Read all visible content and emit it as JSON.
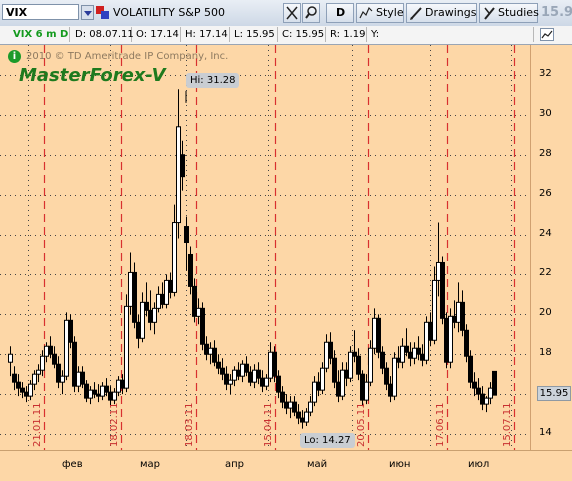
{
  "toolbar": {
    "symbol": "VIX",
    "description": "VOLATILITY S&P 500",
    "period_label": "D",
    "style_label": "Style",
    "drawings_label": "Drawings",
    "studies_label": "Studies",
    "last_price": "15.95"
  },
  "infobar": {
    "timeframe": "VIX 6 m D",
    "date": "D: 08.07.11",
    "open": "O: 17.14",
    "high": "H: 17.14",
    "low": "L: 15.95",
    "close": "C: 15.95",
    "range": "R: 1.19",
    "y": "Y:"
  },
  "chart": {
    "copyright": "2010 © TD Ameritrade IP Company, Inc.",
    "watermark": "MasterForex-V",
    "hi_label": "Hi: 31.28",
    "lo_label": "Lo: 14.27",
    "last_price_tag": "15.95",
    "y_ticks": [
      "32",
      "30",
      "28",
      "26",
      "24",
      "22",
      "20",
      "18",
      "16",
      "14"
    ],
    "x_ticks": [
      "фев",
      "мар",
      "апр",
      "май",
      "июн",
      "июл"
    ],
    "expiration_labels": [
      "21.01.11",
      "18.02.11",
      "18.03.11",
      "15.04.11",
      "20.05.11",
      "17.06.11",
      "15.07.11"
    ],
    "colors": {
      "background": "#fdd7a7",
      "candle": "#000000",
      "expiration_line": "#d83030",
      "grid": "#333333"
    }
  },
  "chart_data": {
    "type": "candlestick",
    "title": "VOLATILITY S&P 500",
    "symbol": "VIX",
    "ylim": [
      13.2,
      33.5
    ],
    "hi": 31.28,
    "lo": 14.27,
    "last": 15.95,
    "candles": [
      {
        "o": 17.6,
        "h": 18.4,
        "l": 16.9,
        "c": 18.0
      },
      {
        "o": 17.0,
        "h": 17.4,
        "l": 16.2,
        "c": 16.6
      },
      {
        "o": 16.6,
        "h": 17.0,
        "l": 15.9,
        "c": 16.3
      },
      {
        "o": 16.3,
        "h": 16.6,
        "l": 15.8,
        "c": 16.1
      },
      {
        "o": 16.1,
        "h": 16.4,
        "l": 15.6,
        "c": 15.9
      },
      {
        "o": 15.9,
        "h": 16.7,
        "l": 15.7,
        "c": 16.5
      },
      {
        "o": 16.5,
        "h": 17.2,
        "l": 16.2,
        "c": 17.0
      },
      {
        "o": 17.0,
        "h": 17.5,
        "l": 16.6,
        "c": 17.2
      },
      {
        "o": 17.2,
        "h": 18.2,
        "l": 16.9,
        "c": 17.9
      },
      {
        "o": 17.9,
        "h": 18.6,
        "l": 17.6,
        "c": 18.4
      },
      {
        "o": 18.4,
        "h": 18.9,
        "l": 17.8,
        "c": 18.0
      },
      {
        "o": 18.0,
        "h": 18.4,
        "l": 17.3,
        "c": 17.5
      },
      {
        "o": 17.5,
        "h": 17.9,
        "l": 16.3,
        "c": 16.6
      },
      {
        "o": 16.6,
        "h": 17.2,
        "l": 16.0,
        "c": 16.9
      },
      {
        "o": 16.9,
        "h": 20.1,
        "l": 16.7,
        "c": 19.7
      },
      {
        "o": 19.7,
        "h": 20.0,
        "l": 18.3,
        "c": 18.6
      },
      {
        "o": 18.6,
        "h": 18.9,
        "l": 16.1,
        "c": 16.4
      },
      {
        "o": 16.4,
        "h": 17.4,
        "l": 16.1,
        "c": 17.1
      },
      {
        "o": 17.1,
        "h": 17.4,
        "l": 16.3,
        "c": 16.5
      },
      {
        "o": 16.5,
        "h": 16.7,
        "l": 15.6,
        "c": 15.8
      },
      {
        "o": 15.8,
        "h": 16.4,
        "l": 15.5,
        "c": 16.2
      },
      {
        "o": 16.2,
        "h": 16.6,
        "l": 15.8,
        "c": 16.0
      },
      {
        "o": 16.0,
        "h": 16.5,
        "l": 15.6,
        "c": 15.9
      },
      {
        "o": 15.9,
        "h": 16.6,
        "l": 15.7,
        "c": 16.4
      },
      {
        "o": 16.4,
        "h": 16.8,
        "l": 15.9,
        "c": 16.1
      },
      {
        "o": 16.1,
        "h": 16.4,
        "l": 15.4,
        "c": 15.7
      },
      {
        "o": 15.7,
        "h": 16.3,
        "l": 15.5,
        "c": 16.1
      },
      {
        "o": 16.1,
        "h": 16.9,
        "l": 15.9,
        "c": 16.7
      },
      {
        "o": 16.7,
        "h": 17.0,
        "l": 16.0,
        "c": 16.3
      },
      {
        "o": 16.3,
        "h": 21.0,
        "l": 16.1,
        "c": 20.4
      },
      {
        "o": 20.4,
        "h": 23.1,
        "l": 20.0,
        "c": 22.1
      },
      {
        "o": 22.1,
        "h": 22.6,
        "l": 19.3,
        "c": 19.6
      },
      {
        "o": 19.6,
        "h": 20.0,
        "l": 18.3,
        "c": 18.8
      },
      {
        "o": 18.8,
        "h": 21.1,
        "l": 18.6,
        "c": 20.6
      },
      {
        "o": 20.6,
        "h": 21.6,
        "l": 19.9,
        "c": 20.2
      },
      {
        "o": 20.2,
        "h": 21.2,
        "l": 19.2,
        "c": 19.6
      },
      {
        "o": 19.6,
        "h": 20.6,
        "l": 19.0,
        "c": 20.3
      },
      {
        "o": 20.3,
        "h": 21.4,
        "l": 20.1,
        "c": 21.0
      },
      {
        "o": 21.0,
        "h": 21.6,
        "l": 20.3,
        "c": 20.5
      },
      {
        "o": 20.5,
        "h": 22.0,
        "l": 20.3,
        "c": 21.7
      },
      {
        "o": 21.7,
        "h": 22.1,
        "l": 20.8,
        "c": 21.1
      },
      {
        "o": 21.1,
        "h": 25.5,
        "l": 20.9,
        "c": 24.6
      },
      {
        "o": 24.6,
        "h": 31.28,
        "l": 23.8,
        "c": 29.4
      },
      {
        "o": 28.0,
        "h": 28.7,
        "l": 26.2,
        "c": 26.9
      },
      {
        "o": 24.4,
        "h": 24.9,
        "l": 22.2,
        "c": 23.6
      },
      {
        "o": 23.0,
        "h": 23.4,
        "l": 21.0,
        "c": 21.4
      },
      {
        "o": 21.4,
        "h": 21.8,
        "l": 19.6,
        "c": 19.9
      },
      {
        "o": 19.9,
        "h": 20.8,
        "l": 19.5,
        "c": 20.3
      },
      {
        "o": 20.3,
        "h": 20.6,
        "l": 18.2,
        "c": 18.5
      },
      {
        "o": 18.5,
        "h": 18.9,
        "l": 17.7,
        "c": 18.0
      },
      {
        "o": 18.0,
        "h": 18.6,
        "l": 17.5,
        "c": 18.3
      },
      {
        "o": 18.3,
        "h": 18.7,
        "l": 17.4,
        "c": 17.6
      },
      {
        "o": 17.6,
        "h": 18.0,
        "l": 17.0,
        "c": 17.3
      },
      {
        "o": 17.3,
        "h": 17.8,
        "l": 16.7,
        "c": 17.0
      },
      {
        "o": 17.0,
        "h": 17.4,
        "l": 16.2,
        "c": 16.5
      },
      {
        "o": 16.5,
        "h": 17.0,
        "l": 16.0,
        "c": 16.7
      },
      {
        "o": 16.7,
        "h": 17.4,
        "l": 16.4,
        "c": 17.2
      },
      {
        "o": 17.2,
        "h": 17.6,
        "l": 16.7,
        "c": 16.9
      },
      {
        "o": 16.9,
        "h": 17.7,
        "l": 16.6,
        "c": 17.5
      },
      {
        "o": 17.5,
        "h": 17.9,
        "l": 16.9,
        "c": 17.1
      },
      {
        "o": 17.1,
        "h": 17.4,
        "l": 16.4,
        "c": 16.6
      },
      {
        "o": 16.6,
        "h": 17.5,
        "l": 16.3,
        "c": 17.2
      },
      {
        "o": 17.2,
        "h": 17.6,
        "l": 16.5,
        "c": 16.8
      },
      {
        "o": 16.8,
        "h": 17.2,
        "l": 16.1,
        "c": 16.4
      },
      {
        "o": 16.4,
        "h": 17.0,
        "l": 16.2,
        "c": 16.8
      },
      {
        "o": 16.8,
        "h": 18.6,
        "l": 16.6,
        "c": 18.1
      },
      {
        "o": 18.1,
        "h": 18.4,
        "l": 16.6,
        "c": 16.9
      },
      {
        "o": 16.9,
        "h": 17.2,
        "l": 15.8,
        "c": 16.1
      },
      {
        "o": 16.1,
        "h": 16.4,
        "l": 15.3,
        "c": 15.6
      },
      {
        "o": 15.6,
        "h": 16.0,
        "l": 15.0,
        "c": 15.3
      },
      {
        "o": 15.3,
        "h": 15.9,
        "l": 14.8,
        "c": 15.6
      },
      {
        "o": 15.6,
        "h": 15.9,
        "l": 14.9,
        "c": 15.1
      },
      {
        "o": 15.1,
        "h": 15.5,
        "l": 14.5,
        "c": 14.8
      },
      {
        "o": 14.8,
        "h": 15.2,
        "l": 14.27,
        "c": 14.6
      },
      {
        "o": 14.6,
        "h": 15.3,
        "l": 14.4,
        "c": 15.1
      },
      {
        "o": 15.1,
        "h": 15.9,
        "l": 14.9,
        "c": 15.6
      },
      {
        "o": 15.6,
        "h": 16.9,
        "l": 15.4,
        "c": 16.6
      },
      {
        "o": 16.6,
        "h": 17.1,
        "l": 15.9,
        "c": 16.2
      },
      {
        "o": 16.2,
        "h": 17.6,
        "l": 16.0,
        "c": 17.3
      },
      {
        "o": 17.3,
        "h": 19.0,
        "l": 17.1,
        "c": 18.6
      },
      {
        "o": 18.6,
        "h": 19.1,
        "l": 17.5,
        "c": 17.8
      },
      {
        "o": 17.8,
        "h": 18.2,
        "l": 16.3,
        "c": 16.6
      },
      {
        "o": 16.6,
        "h": 17.2,
        "l": 15.6,
        "c": 15.9
      },
      {
        "o": 15.9,
        "h": 17.6,
        "l": 15.7,
        "c": 17.2
      },
      {
        "o": 17.2,
        "h": 17.6,
        "l": 16.4,
        "c": 16.8
      },
      {
        "o": 16.8,
        "h": 18.4,
        "l": 16.6,
        "c": 18.1
      },
      {
        "o": 18.1,
        "h": 19.2,
        "l": 17.6,
        "c": 17.9
      },
      {
        "o": 17.9,
        "h": 18.3,
        "l": 16.7,
        "c": 17.0
      },
      {
        "o": 17.0,
        "h": 17.2,
        "l": 15.4,
        "c": 15.7
      },
      {
        "o": 15.7,
        "h": 17.0,
        "l": 15.5,
        "c": 16.6
      },
      {
        "o": 16.6,
        "h": 18.7,
        "l": 16.4,
        "c": 18.3
      },
      {
        "o": 18.3,
        "h": 20.3,
        "l": 18.0,
        "c": 19.8
      },
      {
        "o": 19.8,
        "h": 20.0,
        "l": 17.8,
        "c": 18.1
      },
      {
        "o": 18.1,
        "h": 18.4,
        "l": 17.0,
        "c": 17.3
      },
      {
        "o": 17.3,
        "h": 17.6,
        "l": 16.2,
        "c": 16.5
      },
      {
        "o": 16.5,
        "h": 16.9,
        "l": 15.6,
        "c": 15.9
      },
      {
        "o": 15.9,
        "h": 18.1,
        "l": 15.7,
        "c": 17.8
      },
      {
        "o": 17.8,
        "h": 18.4,
        "l": 17.3,
        "c": 17.6
      },
      {
        "o": 17.6,
        "h": 18.8,
        "l": 17.3,
        "c": 18.4
      },
      {
        "o": 18.4,
        "h": 19.3,
        "l": 17.9,
        "c": 18.1
      },
      {
        "o": 18.1,
        "h": 18.6,
        "l": 17.4,
        "c": 17.8
      },
      {
        "o": 17.8,
        "h": 18.6,
        "l": 17.5,
        "c": 18.3
      },
      {
        "o": 18.3,
        "h": 18.9,
        "l": 17.7,
        "c": 18.0
      },
      {
        "o": 18.0,
        "h": 18.5,
        "l": 17.4,
        "c": 17.7
      },
      {
        "o": 17.7,
        "h": 19.9,
        "l": 17.5,
        "c": 19.6
      },
      {
        "o": 19.6,
        "h": 20.1,
        "l": 18.4,
        "c": 18.7
      },
      {
        "o": 18.7,
        "h": 22.4,
        "l": 18.5,
        "c": 21.7
      },
      {
        "o": 21.7,
        "h": 24.6,
        "l": 20.9,
        "c": 22.6
      },
      {
        "o": 22.6,
        "h": 22.9,
        "l": 19.5,
        "c": 19.8
      },
      {
        "o": 19.8,
        "h": 20.1,
        "l": 17.3,
        "c": 17.6
      },
      {
        "o": 17.6,
        "h": 20.3,
        "l": 17.3,
        "c": 19.9
      },
      {
        "o": 19.9,
        "h": 20.7,
        "l": 19.3,
        "c": 19.6
      },
      {
        "o": 19.6,
        "h": 21.6,
        "l": 19.1,
        "c": 20.6
      },
      {
        "o": 20.6,
        "h": 21.2,
        "l": 18.9,
        "c": 19.2
      },
      {
        "o": 19.2,
        "h": 19.5,
        "l": 17.6,
        "c": 17.9
      },
      {
        "o": 17.9,
        "h": 18.2,
        "l": 16.3,
        "c": 16.6
      },
      {
        "o": 16.6,
        "h": 17.1,
        "l": 15.9,
        "c": 16.3
      },
      {
        "o": 16.3,
        "h": 16.8,
        "l": 15.7,
        "c": 16.0
      },
      {
        "o": 16.0,
        "h": 16.4,
        "l": 15.2,
        "c": 15.5
      },
      {
        "o": 15.5,
        "h": 15.9,
        "l": 15.1,
        "c": 15.8
      },
      {
        "o": 15.8,
        "h": 16.6,
        "l": 15.5,
        "c": 16.3
      },
      {
        "o": 17.14,
        "h": 17.14,
        "l": 15.95,
        "c": 15.95
      }
    ]
  }
}
